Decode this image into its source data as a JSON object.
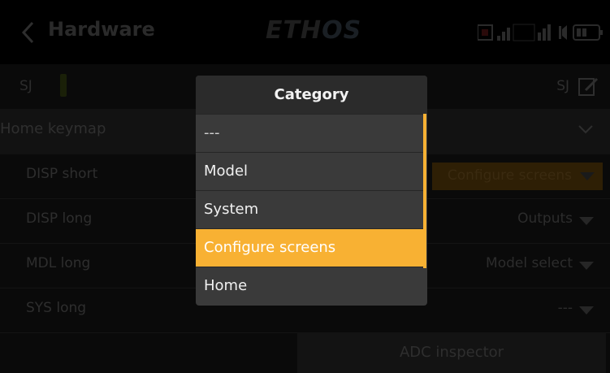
{
  "header": {
    "title": "Hardware",
    "brand_main": "ETH",
    "brand_accent": "OS"
  },
  "switch_row": {
    "left_label": "SJ",
    "right_label": "SJ"
  },
  "section": {
    "label": "Home keymap"
  },
  "rows": [
    {
      "label": "DISP short",
      "value": "Configure screens"
    },
    {
      "label": "DISP long",
      "value": "Outputs"
    },
    {
      "label": "MDL long",
      "value": "Model select"
    },
    {
      "label": "SYS long",
      "value": "---"
    }
  ],
  "bottom_button": {
    "label": "ADC inspector"
  },
  "popup": {
    "title": "Category",
    "options": [
      "---",
      "Model",
      "System",
      "Configure screens",
      "Home"
    ],
    "selected_index": 3
  },
  "colors": {
    "accent": "#f8b133",
    "popup_bg": "#3a3a3a",
    "popup_title_bg": "#2b2b2b"
  },
  "icons": [
    "chevron-left-icon",
    "record-icon",
    "signal-bars-icon",
    "volume-icon",
    "battery-icon",
    "edit-icon",
    "chevron-down-icon",
    "caret-down-icon"
  ]
}
